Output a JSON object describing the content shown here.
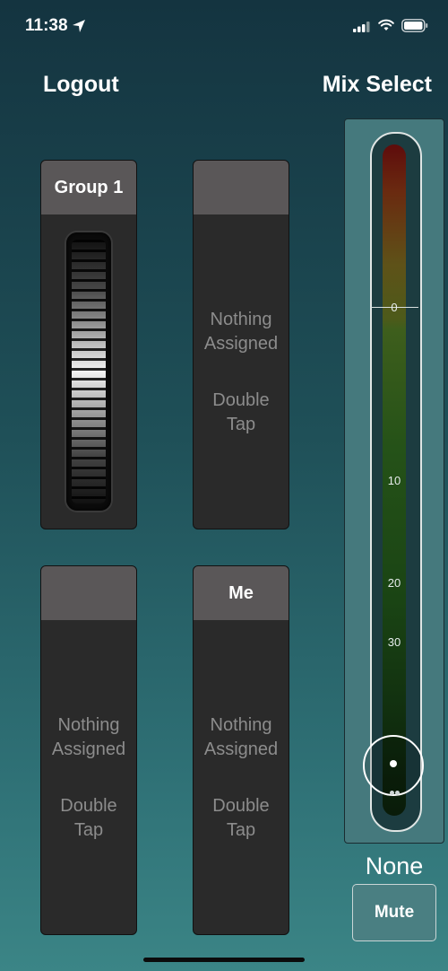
{
  "status_bar": {
    "time": "11:38"
  },
  "header": {
    "logout_label": "Logout",
    "mix_select_label": "Mix Select"
  },
  "cards": [
    {
      "title": "Group 1"
    },
    {
      "title": "",
      "assigned": "Nothing\nAssigned",
      "double_tap": "Double\nTap"
    },
    {
      "title": "",
      "assigned": "Nothing\nAssigned",
      "double_tap": "Double\nTap"
    },
    {
      "title": "Me",
      "assigned": "Nothing\nAssigned",
      "double_tap": "Double\nTap"
    }
  ],
  "meter": {
    "ticks": [
      "0",
      "10",
      "20",
      "30"
    ],
    "value_label": "None"
  },
  "mute_label": "Mute",
  "colors": {
    "accent_meter_top": "#5e0c0c",
    "accent_meter_mid": "#255218",
    "mute_bg": "#4a7f82"
  }
}
